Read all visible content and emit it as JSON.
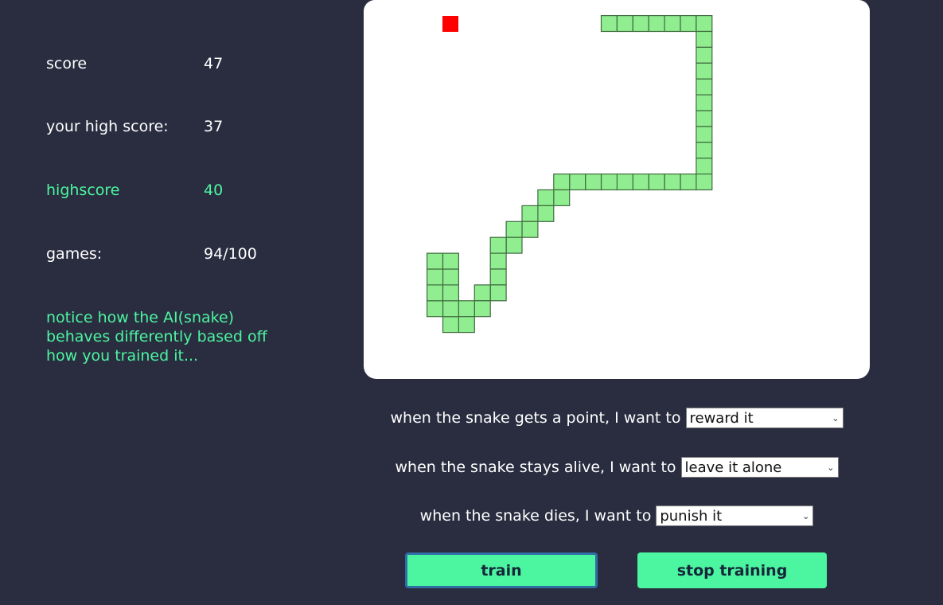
{
  "stats": {
    "score_label": "score",
    "score_value": "47",
    "your_high_score_label": "your high score:",
    "your_high_score_value": "37",
    "highscore_label": "highscore",
    "highscore_value": "40",
    "games_label": "games:",
    "games_value": "94/100",
    "notice": "notice how the AI(snake) behaves differently based off how you trained it..."
  },
  "board": {
    "grid_cols": 32,
    "grid_rows": 24,
    "food": [
      5,
      1
    ],
    "snake": [
      [
        15,
        1
      ],
      [
        16,
        1
      ],
      [
        17,
        1
      ],
      [
        18,
        1
      ],
      [
        19,
        1
      ],
      [
        20,
        1
      ],
      [
        21,
        1
      ],
      [
        21,
        2
      ],
      [
        21,
        3
      ],
      [
        21,
        4
      ],
      [
        21,
        5
      ],
      [
        21,
        6
      ],
      [
        21,
        7
      ],
      [
        21,
        8
      ],
      [
        21,
        9
      ],
      [
        21,
        10
      ],
      [
        21,
        11
      ],
      [
        20,
        11
      ],
      [
        19,
        11
      ],
      [
        18,
        11
      ],
      [
        17,
        11
      ],
      [
        16,
        11
      ],
      [
        15,
        11
      ],
      [
        14,
        11
      ],
      [
        13,
        11
      ],
      [
        12,
        11
      ],
      [
        12,
        12
      ],
      [
        11,
        12
      ],
      [
        11,
        13
      ],
      [
        10,
        13
      ],
      [
        10,
        14
      ],
      [
        9,
        14
      ],
      [
        9,
        15
      ],
      [
        8,
        15
      ],
      [
        8,
        16
      ],
      [
        8,
        17
      ],
      [
        8,
        18
      ],
      [
        7,
        18
      ],
      [
        7,
        19
      ],
      [
        6,
        19
      ],
      [
        6,
        20
      ],
      [
        5,
        20
      ],
      [
        5,
        19
      ],
      [
        4,
        19
      ],
      [
        4,
        18
      ],
      [
        5,
        18
      ],
      [
        5,
        17
      ],
      [
        4,
        17
      ],
      [
        4,
        16
      ],
      [
        5,
        16
      ]
    ],
    "colors": {
      "snake_fill": "#90ee90",
      "snake_stroke": "#3f6b3f",
      "food": "#ff0000"
    }
  },
  "controls": {
    "point_question": "when the snake gets a point, I want to",
    "point_selected": "reward it",
    "alive_question": "when the snake stays alive, I want to",
    "alive_selected": "leave it alone",
    "die_question": "when the snake dies, I want to",
    "die_selected": "punish it",
    "train_label": "train",
    "stop_label": "stop training"
  },
  "colors": {
    "background": "#2a2d40",
    "accent": "#4cf5a0"
  }
}
